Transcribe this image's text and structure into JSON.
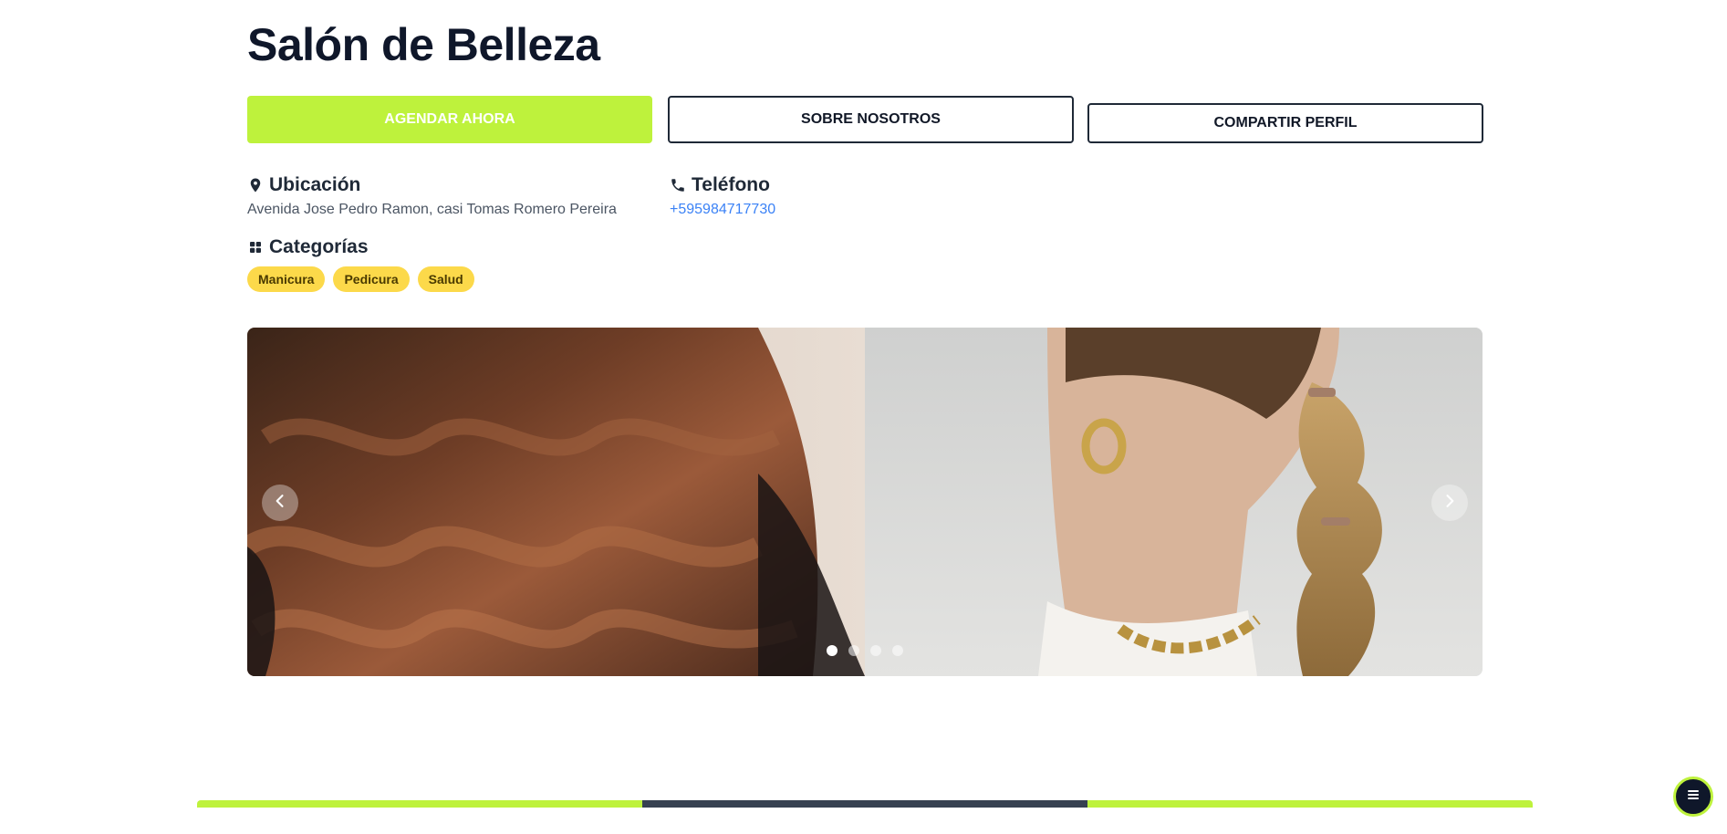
{
  "page": {
    "title": "Salón de Belleza"
  },
  "actions": {
    "book_label": "AGENDAR AHORA",
    "about_label": "SOBRE NOSOTROS",
    "share_label": "COMPARTIR PERFIL"
  },
  "location": {
    "icon": "map-pin-icon",
    "heading": "Ubicación",
    "address": "Avenida Jose Pedro Ramon, casi Tomas Romero Pereira"
  },
  "phone": {
    "icon": "phone-icon",
    "heading": "Teléfono",
    "number": "+595984717730"
  },
  "categories": {
    "icon": "grid-icon",
    "heading": "Categorías",
    "items": [
      "Manicura",
      "Pedicura",
      "Salud"
    ]
  },
  "carousel": {
    "slide_count": 4,
    "active_index": 0,
    "prev_icon": "chevron-left-icon",
    "next_icon": "chevron-right-icon"
  },
  "fab": {
    "icon": "menu-icon"
  },
  "colors": {
    "accent": "#bef23c",
    "dark": "#0f172a",
    "tag": "#fcd94a",
    "link": "#3b82f6"
  }
}
